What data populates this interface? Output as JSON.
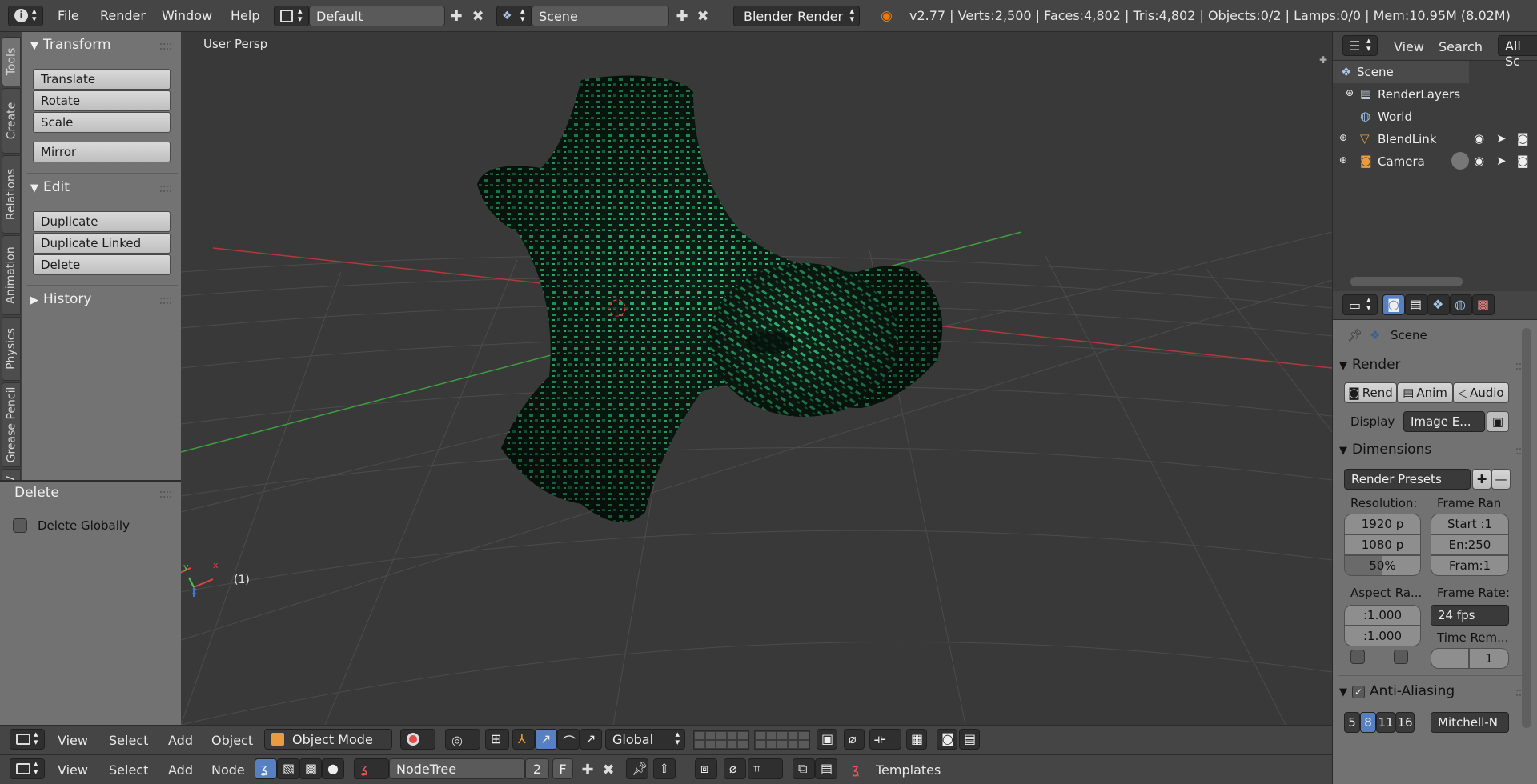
{
  "topbar": {
    "menus": [
      "File",
      "Render",
      "Window",
      "Help"
    ],
    "layout": "Default",
    "scene": "Scene",
    "engine": "Blender Render",
    "stats": "v2.77 | Verts:2,500 | Faces:4,802 | Tris:4,802 | Objects:0/2 | Lamps:0/0 | Mem:10.95M (8.02M)"
  },
  "left_tabs": [
    "Tools",
    "Create",
    "Relations",
    "Animation",
    "Physics",
    "Grease Pencil",
    "SV"
  ],
  "toolshelf": {
    "transform": {
      "title": "Transform",
      "buttons": [
        "Translate",
        "Rotate",
        "Scale",
        "Mirror"
      ]
    },
    "edit": {
      "title": "Edit",
      "buttons": [
        "Duplicate",
        "Duplicate Linked",
        "Delete"
      ]
    },
    "history": {
      "title": "History"
    }
  },
  "operator_panel": {
    "title": "Delete",
    "checkbox_label": "Delete Globally",
    "checked": false
  },
  "viewport": {
    "label": "User Persp",
    "frame": "(1)",
    "axis_x": "x",
    "axis_y": "y",
    "axis_z": "z"
  },
  "view_header": {
    "menus": [
      "View",
      "Select",
      "Add",
      "Object"
    ],
    "mode": "Object Mode",
    "orientation": "Global"
  },
  "node_header": {
    "menus": [
      "View",
      "Select",
      "Add",
      "Node"
    ],
    "tree": "NodeTree",
    "users": "2",
    "fake": "F",
    "templates": "Templates"
  },
  "outliner": {
    "menus": [
      "View",
      "Search"
    ],
    "filter": "All Sc",
    "items": [
      {
        "name": "Scene",
        "icon": "scene-icon"
      },
      {
        "name": "RenderLayers",
        "icon": "renderlayers-icon"
      },
      {
        "name": "World",
        "icon": "world-icon"
      },
      {
        "name": "BlendLink",
        "icon": "mesh-icon"
      },
      {
        "name": "Camera",
        "icon": "camera-icon"
      }
    ]
  },
  "properties": {
    "context": "Scene",
    "render": {
      "title": "Render",
      "buttons": [
        "Rend",
        "Anim",
        "Audio"
      ],
      "display_label": "Display",
      "display_value": "Image E..."
    },
    "dimensions": {
      "title": "Dimensions",
      "presets": "Render Presets",
      "resolution_label": "Resolution:",
      "res_x": "1920 p",
      "res_y": "1080 p",
      "res_pct": "50%",
      "frame_range_label": "Frame Ran",
      "start": "Start :1",
      "end": "En:250",
      "step": "Fram:1",
      "aspect_label": "Aspect Ra...",
      "aspect_x": ":1.000",
      "aspect_y": ":1.000",
      "frame_rate_label": "Frame Rate:",
      "fps": "24 fps",
      "time_remap_label": "Time Rem...",
      "time_remap": "1"
    },
    "anti_aliasing": {
      "title": "Anti-Aliasing",
      "samples": [
        "5",
        "8",
        "11",
        "16"
      ],
      "filter": "Mitchell-N"
    }
  },
  "colors": {
    "mesh": "#2fbf75",
    "x_axis": "#b03a3a",
    "y_axis": "#3f9e3f",
    "selected_sample": "#5680c2"
  }
}
